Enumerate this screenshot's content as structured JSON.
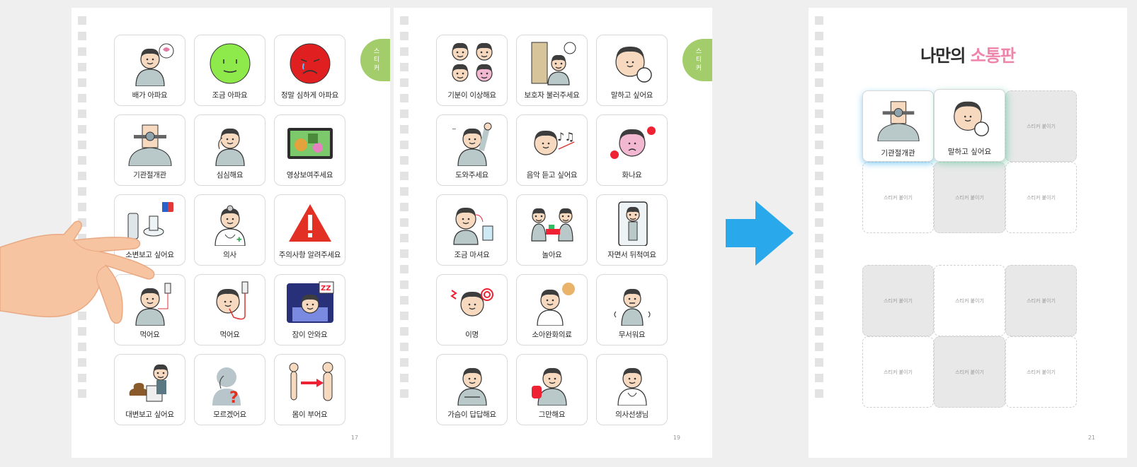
{
  "page1": {
    "number": "17",
    "tab": "스티커",
    "cards": [
      {
        "label": "배가 아파요",
        "icon": "stomach-ache-icon"
      },
      {
        "label": "조금 아파요",
        "icon": "green-face-icon"
      },
      {
        "label": "정말 심하게 아파요",
        "icon": "red-face-icon"
      },
      {
        "label": "기관절개관",
        "icon": "tracheostomy-icon"
      },
      {
        "label": "심심해요",
        "icon": "bored-icon"
      },
      {
        "label": "영상보여주세요",
        "icon": "video-screen-icon"
      },
      {
        "label": "소변보고 싶어요",
        "icon": "toilet-icon"
      },
      {
        "label": "의사",
        "icon": "doctor-icon"
      },
      {
        "label": "주의사항 알려주세요",
        "icon": "warning-icon"
      },
      {
        "label": "먹어요",
        "icon": "iv-feeding-icon"
      },
      {
        "label": "먹어요",
        "icon": "tube-feeding-icon"
      },
      {
        "label": "잠이 안와요",
        "icon": "cant-sleep-icon"
      },
      {
        "label": "대변보고 싶어요",
        "icon": "bowel-icon"
      },
      {
        "label": "모르겠어요",
        "icon": "question-icon"
      },
      {
        "label": "몸이 부어요",
        "icon": "swelling-icon"
      }
    ]
  },
  "page2": {
    "number": "19",
    "tab": "스티커",
    "cards": [
      {
        "label": "기분이 이상해요",
        "icon": "four-faces-icon"
      },
      {
        "label": "보호자 불러주세요",
        "icon": "call-guardian-icon"
      },
      {
        "label": "말하고 싶어요",
        "icon": "want-talk-icon"
      },
      {
        "label": "도와주세요",
        "icon": "help-icon"
      },
      {
        "label": "음악 듣고 싶어요",
        "icon": "music-icon"
      },
      {
        "label": "화나요",
        "icon": "angry-icon"
      },
      {
        "label": "조금 마셔요",
        "icon": "drink-icon"
      },
      {
        "label": "놀아요",
        "icon": "play-icon"
      },
      {
        "label": "자면서 뒤척여요",
        "icon": "toss-turn-icon"
      },
      {
        "label": "이명",
        "icon": "tinnitus-icon"
      },
      {
        "label": "소아완화의료",
        "icon": "palliative-icon"
      },
      {
        "label": "무서워요",
        "icon": "scared-icon"
      },
      {
        "label": "가슴이 답답해요",
        "icon": "chest-tight-icon"
      },
      {
        "label": "그만해요",
        "icon": "stop-icon"
      },
      {
        "label": "의사선생님",
        "icon": "doctor-female-icon"
      }
    ]
  },
  "page3": {
    "number": "21",
    "title_main": "나만의",
    "title_accent": "소통판",
    "placeholder": "스티커 붙이기",
    "placed": [
      {
        "label": "기관절개관",
        "icon": "tracheostomy-icon"
      },
      {
        "label": "말하고 싶어요",
        "icon": "want-talk-icon"
      }
    ]
  },
  "colors": {
    "accent_pink": "#ef84aa",
    "tab_green": "#a3cd6b",
    "arrow_blue": "#29a9ec"
  }
}
